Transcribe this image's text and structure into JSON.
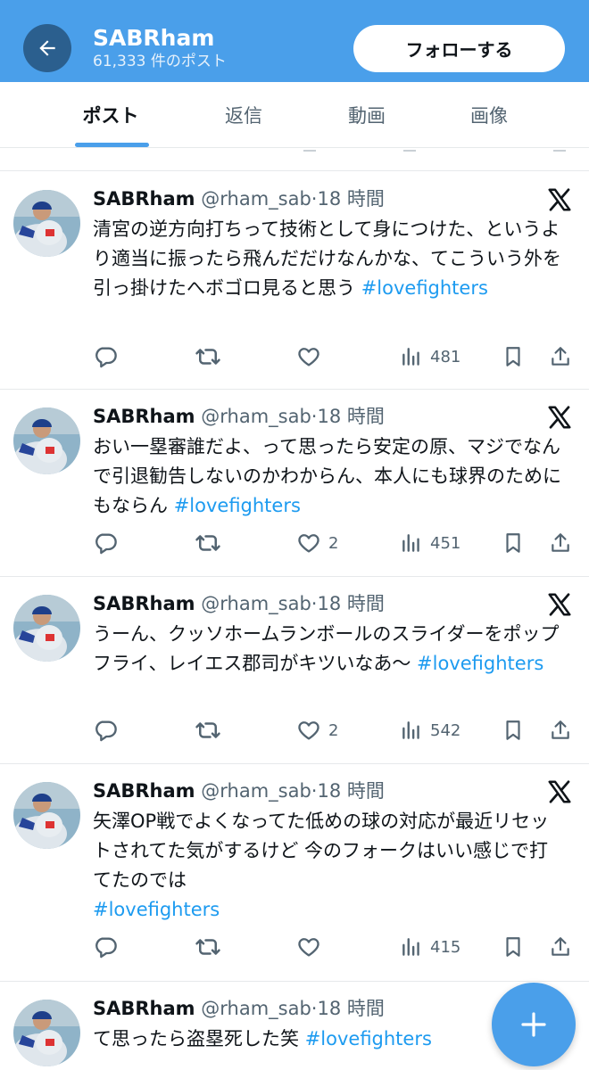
{
  "header": {
    "title": "SABRham",
    "subtitle": "61,333 件のポスト",
    "follow_label": "フォローする",
    "accent_color": "#4a9fea"
  },
  "tabs": [
    {
      "label": "ポスト",
      "active": true
    },
    {
      "label": "返信",
      "active": false
    },
    {
      "label": "動画",
      "active": false
    },
    {
      "label": "画像",
      "active": false
    }
  ],
  "posts": [
    {
      "name": "SABRham",
      "handle": "@rham_sab",
      "sep": "·",
      "time": "18 時間",
      "text": "清宮の逆方向打ちって技術として身につけた、というより適当に振ったら飛んだだけなんかな、てこういう外を引っ掛けたへボゴロ見ると思う ",
      "hashtag": "#lovefighters",
      "likes": "",
      "views": "481"
    },
    {
      "name": "SABRham",
      "handle": "@rham_sab",
      "sep": "·",
      "time": "18 時間",
      "text": "おい一塁審誰だよ、って思ったら安定の原、マジでなんで引退勧告しないのかわからん、本人にも球界のためにもならん ",
      "hashtag": "#lovefighters",
      "likes": "2",
      "views": "451"
    },
    {
      "name": "SABRham",
      "handle": "@rham_sab",
      "sep": "·",
      "time": "18 時間",
      "text": "うーん、クッソホームランボールのスライダーをポップフライ、レイエス郡司がキツいなあ〜 ",
      "hashtag": "#lovefighters",
      "likes": "2",
      "views": "542"
    },
    {
      "name": "SABRham",
      "handle": "@rham_sab",
      "sep": "·",
      "time": "18 時間",
      "text": "矢澤OP戦でよくなってた低めの球の対応が最近リセットされてた気がするけど 今のフォークはいい感じで打てたのでは",
      "hashtag": "#lovefighters",
      "likes": "",
      "views": "415"
    },
    {
      "name": "SABRham",
      "handle": "@rham_sab",
      "sep": "·",
      "time": "18 時間",
      "text": "て思ったら盗塁死した笑 ",
      "hashtag": "#lovefighters",
      "likes": "",
      "views": ""
    }
  ],
  "icons": {
    "back": "arrow-left-icon",
    "brand": "x-logo-icon",
    "reply": "reply-icon",
    "repost": "repost-icon",
    "like": "heart-icon",
    "views": "views-icon",
    "bookmark": "bookmark-icon",
    "share": "share-icon",
    "compose": "plus-icon"
  }
}
